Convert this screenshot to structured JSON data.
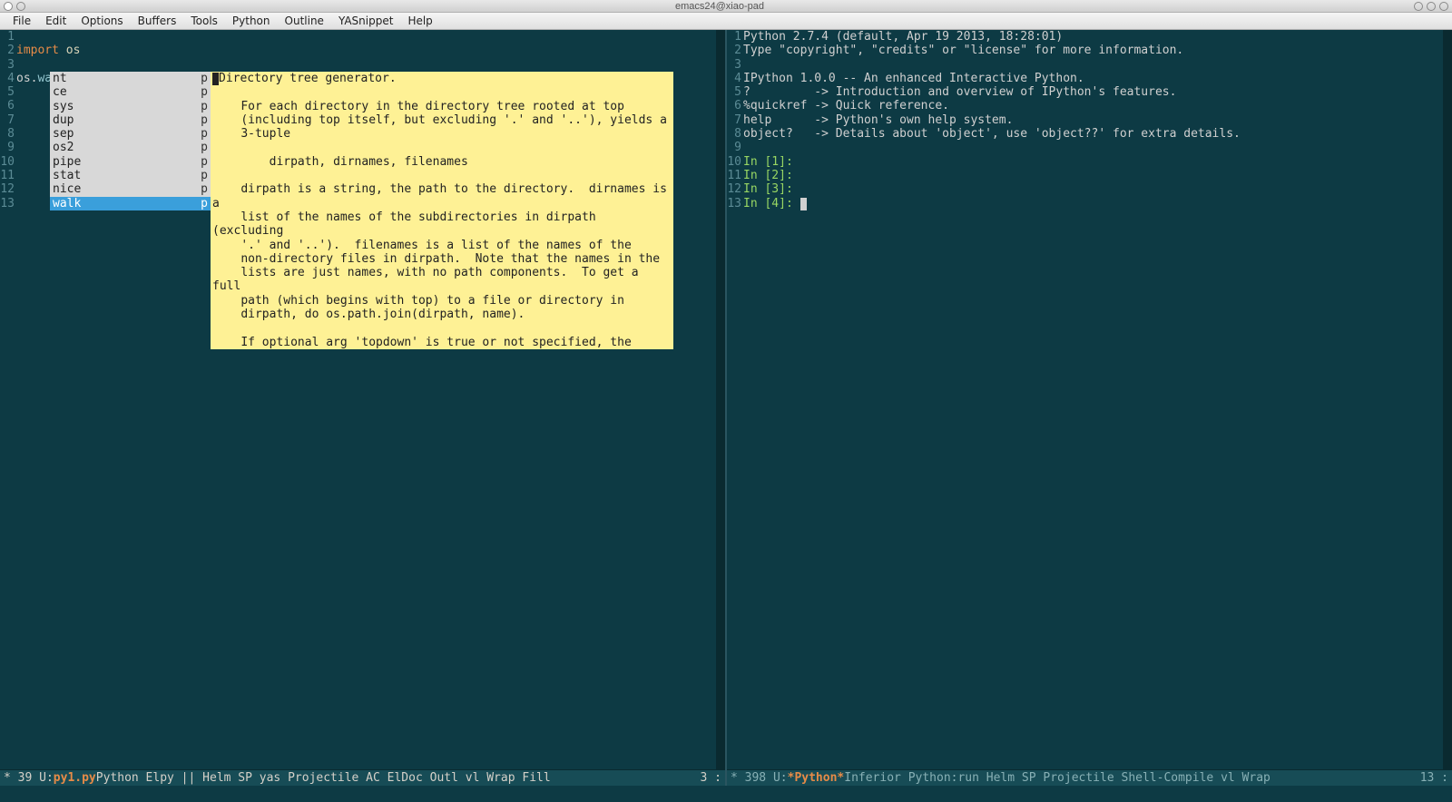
{
  "window": {
    "title": "emacs24@xiao-pad"
  },
  "menubar": [
    "File",
    "Edit",
    "Options",
    "Buffers",
    "Tools",
    "Python",
    "Outline",
    "YASnippet",
    "Help"
  ],
  "left_pane": {
    "gutter": [
      "1",
      "2",
      "3",
      "4",
      "5",
      "6",
      "7",
      "8",
      "9",
      "10",
      "11",
      "12",
      "13"
    ],
    "lines": {
      "import_kw": "import",
      "module": "os",
      "call_prefix": "os.",
      "call_attr": "walk"
    },
    "completions": [
      {
        "name": "nt",
        "kind": "p"
      },
      {
        "name": "ce",
        "kind": "p"
      },
      {
        "name": "sys",
        "kind": "p"
      },
      {
        "name": "dup",
        "kind": "p"
      },
      {
        "name": "sep",
        "kind": "p"
      },
      {
        "name": "os2",
        "kind": "p"
      },
      {
        "name": "pipe",
        "kind": "p"
      },
      {
        "name": "stat",
        "kind": "p"
      },
      {
        "name": "nice",
        "kind": "p"
      },
      {
        "name": "walk",
        "kind": "p"
      }
    ],
    "selected_index": 9,
    "doc": "Directory tree generator.\n\n    For each directory in the directory tree rooted at top\n    (including top itself, but excluding '.' and '..'), yields a\n    3-tuple\n\n        dirpath, dirnames, filenames\n\n    dirpath is a string, the path to the directory.  dirnames is a\n    list of the names of the subdirectories in dirpath (excluding\n    '.' and '..').  filenames is a list of the names of the\n    non-directory files in dirpath.  Note that the names in the\n    lists are just names, with no path components.  To get a full\n    path (which begins with top) to a file or directory in\n    dirpath, do os.path.join(dirpath, name).\n\n    If optional arg 'topdown' is true or not specified, the triple\n    for a directory is generated before the triples for any of its\n    subdirectories (directories are generated top down).  If\n    topdown is false, the triple for a directory is generated",
    "modeline_left": " * 39 U: ",
    "modeline_file": "py1.py",
    "modeline_right": "      Python Elpy || Helm SP yas Projectile AC ElDoc Outl vl Wrap Fill ",
    "modeline_pos": "3 :"
  },
  "right_pane": {
    "gutter": [
      "1",
      "2",
      "3",
      "4",
      "5",
      "6",
      "7",
      "8",
      "9",
      "10",
      "11",
      "12",
      "13"
    ],
    "lines": [
      "Python 2.7.4 (default, Apr 19 2013, 18:28:01)",
      "Type \"copyright\", \"credits\" or \"license\" for more information.",
      "",
      "IPython 1.0.0 -- An enhanced Interactive Python.",
      "?         -> Introduction and overview of IPython's features.",
      "%quickref -> Quick reference.",
      "help      -> Python's own help system.",
      "object?   -> Details about 'object', use 'object??' for extra details.",
      ""
    ],
    "prompts": [
      "In [1]:",
      "In [2]:",
      "In [3]:",
      "In [4]: "
    ],
    "modeline_left": " * 398 U: ",
    "modeline_file": "*Python*",
    "modeline_right": "      Inferior Python:run Helm SP Projectile Shell-Compile vl Wrap ",
    "modeline_pos": "13 :"
  }
}
